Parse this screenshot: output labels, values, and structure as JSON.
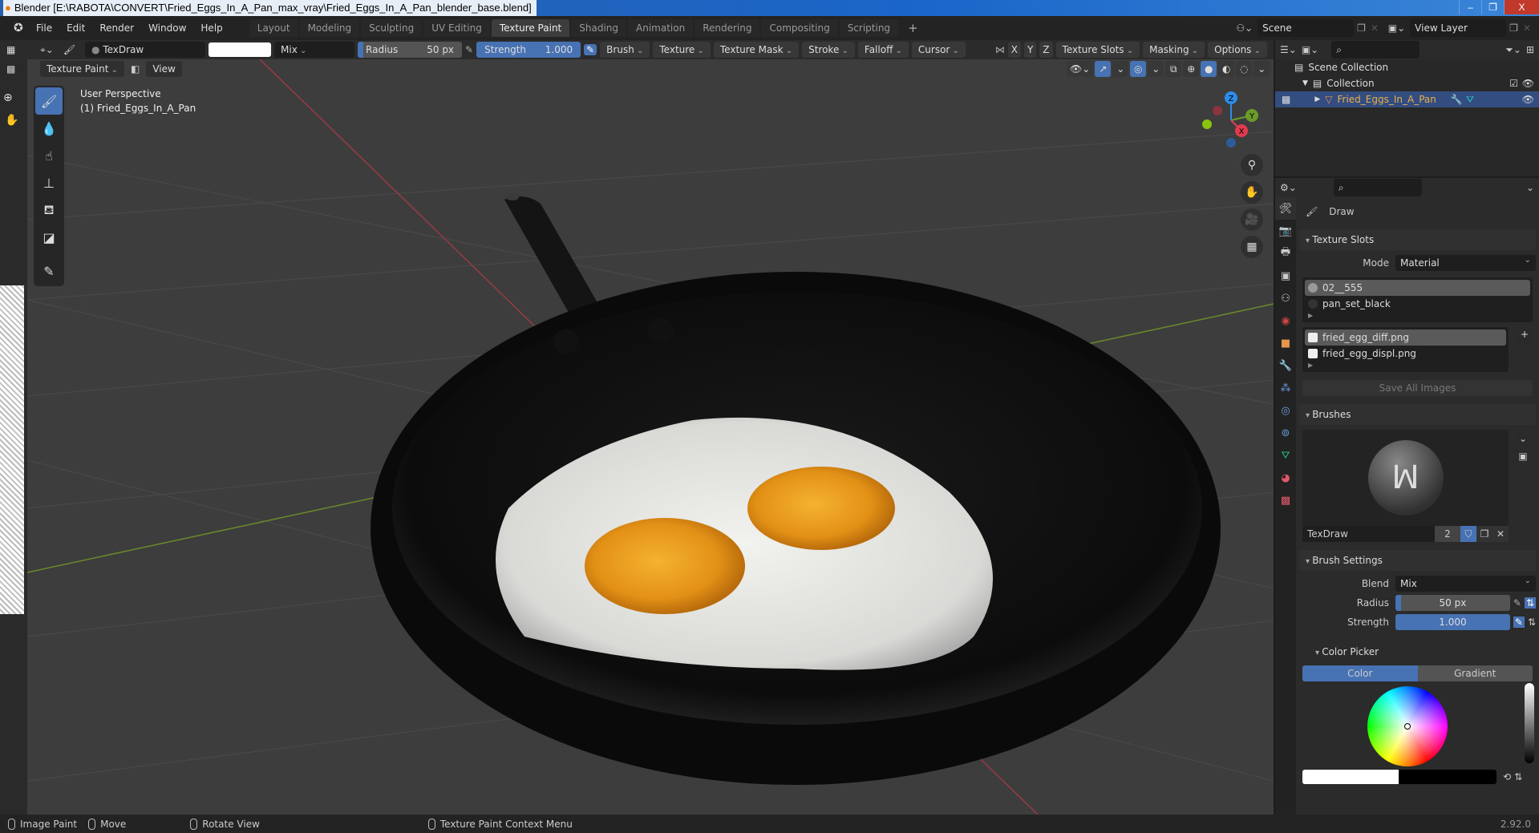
{
  "window": {
    "title": "Blender [E:\\RABOTA\\CONVERT\\Fried_Eggs_In_A_Pan_max_vray\\Fried_Eggs_In_A_Pan_blender_base.blend]",
    "controls": {
      "minimize": "–",
      "restore": "❐",
      "close": "X"
    }
  },
  "menu": {
    "logo": "blender-logo",
    "items": [
      "File",
      "Edit",
      "Render",
      "Window",
      "Help"
    ]
  },
  "workspaces": {
    "tabs": [
      "Layout",
      "Modeling",
      "Sculpting",
      "UV Editing",
      "Texture Paint",
      "Shading",
      "Animation",
      "Rendering",
      "Compositing",
      "Scripting"
    ],
    "active": "Texture Paint",
    "add_label": "+"
  },
  "scene": {
    "label": "Scene",
    "view_layer": "View Layer"
  },
  "tool_header": {
    "brush_name": "TexDraw",
    "color_hex": "#ffffff",
    "blend": "Mix",
    "radius_label": "Radius",
    "radius_value": "50 px",
    "radius_fraction": 0.05,
    "strength_label": "Strength",
    "strength_value": "1.000",
    "strength_fraction": 1.0,
    "menus": [
      "Brush",
      "Texture",
      "Texture Mask",
      "Stroke",
      "Falloff",
      "Cursor"
    ],
    "axes": [
      "X",
      "Y",
      "Z"
    ],
    "right_menus": [
      "Texture Slots",
      "Masking",
      "Options"
    ]
  },
  "viewport_header": {
    "mode": "Texture Paint",
    "view_menu": "View"
  },
  "viewport": {
    "perspective": "User Perspective",
    "object": "(1) Fried_Eggs_In_A_Pan",
    "gizmo_axes": {
      "x": "X",
      "y": "Y",
      "z": "Z"
    },
    "axis_colors": {
      "x": "#e23b4e",
      "y": "#6b9c2a",
      "z": "#2d8ceb",
      "neg_y": "#89c40f"
    }
  },
  "tools": [
    "draw-brush",
    "soften-brush",
    "smear-brush",
    "clone-brush",
    "fill-brush",
    "mask-brush",
    "annotate-tool"
  ],
  "outliner": {
    "scene_collection": "Scene Collection",
    "collection": "Collection",
    "object": "Fried_Eggs_In_A_Pan"
  },
  "properties": {
    "active_tool": "Draw",
    "texture_slots": {
      "title": "Texture Slots",
      "mode_label": "Mode",
      "mode_value": "Material",
      "materials": [
        "02__555",
        "pan_set_black"
      ],
      "images": [
        "fried_egg_diff.png",
        "fried_egg_displ.png"
      ],
      "save_all": "Save All Images"
    },
    "brushes": {
      "title": "Brushes",
      "brush_name": "TexDraw",
      "users": "2"
    },
    "brush_settings": {
      "title": "Brush Settings",
      "blend_label": "Blend",
      "blend_value": "Mix",
      "radius_label": "Radius",
      "radius_value": "50 px",
      "strength_label": "Strength",
      "strength_value": "1.000"
    },
    "color_picker": {
      "title": "Color Picker",
      "tabs": [
        "Color",
        "Gradient"
      ],
      "active_tab": "Color",
      "primary_color": "#ffffff",
      "secondary_color": "#000000"
    }
  },
  "statusbar": {
    "items": [
      "Image Paint",
      "Move",
      "Rotate View",
      "Texture Paint Context Menu"
    ],
    "version": "2.92.0"
  },
  "colors": {
    "accent": "#4772b3",
    "selection": "#334d80",
    "object_name": "#e8b04a"
  }
}
